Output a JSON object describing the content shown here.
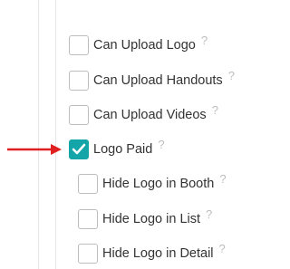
{
  "options": [
    {
      "label": "Can Upload Logo",
      "checked": false,
      "help": "?"
    },
    {
      "label": "Can Upload Handouts",
      "checked": false,
      "help": "?"
    },
    {
      "label": "Can Upload Videos",
      "checked": false,
      "help": "?"
    },
    {
      "label": "Logo Paid",
      "checked": true,
      "help": "?"
    },
    {
      "label": "Hide Logo in Booth",
      "checked": false,
      "help": "?"
    },
    {
      "label": "Hide Logo in List",
      "checked": false,
      "help": "?"
    },
    {
      "label": "Hide Logo in Detail",
      "checked": false,
      "help": "?"
    }
  ],
  "colors": {
    "accent": "#14a5a8",
    "arrow": "#e02020",
    "help": "#bdbdbd"
  }
}
